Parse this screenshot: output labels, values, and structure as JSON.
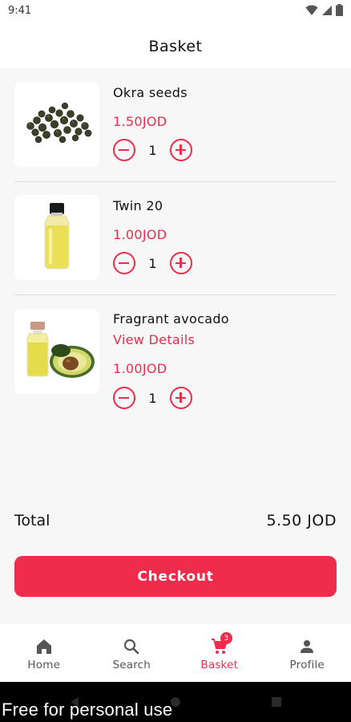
{
  "status": {
    "time": "9:41"
  },
  "header": {
    "title": "Basket"
  },
  "items": [
    {
      "name": "Okra seeds",
      "price": "1.50JOD",
      "quantity": "1"
    },
    {
      "name": "Twin 20",
      "price": "1.00JOD",
      "quantity": "1"
    },
    {
      "name": "Fragrant avocado",
      "details_link": "View Details",
      "price": "1.00JOD",
      "quantity": "1"
    }
  ],
  "summary": {
    "total_label": "Total",
    "total_value": "5.50 JOD"
  },
  "checkout": {
    "label": "Checkout"
  },
  "nav": {
    "items": [
      {
        "label": "Home",
        "icon": "home-icon"
      },
      {
        "label": "Search",
        "icon": "search-icon"
      },
      {
        "label": "Basket",
        "icon": "cart-icon",
        "badge": "3",
        "active": true
      },
      {
        "label": "Profile",
        "icon": "person-icon"
      }
    ]
  },
  "watermark": "Free for personal use",
  "colors": {
    "accent": "#ef2c4b",
    "background": "#f7f7f7"
  }
}
